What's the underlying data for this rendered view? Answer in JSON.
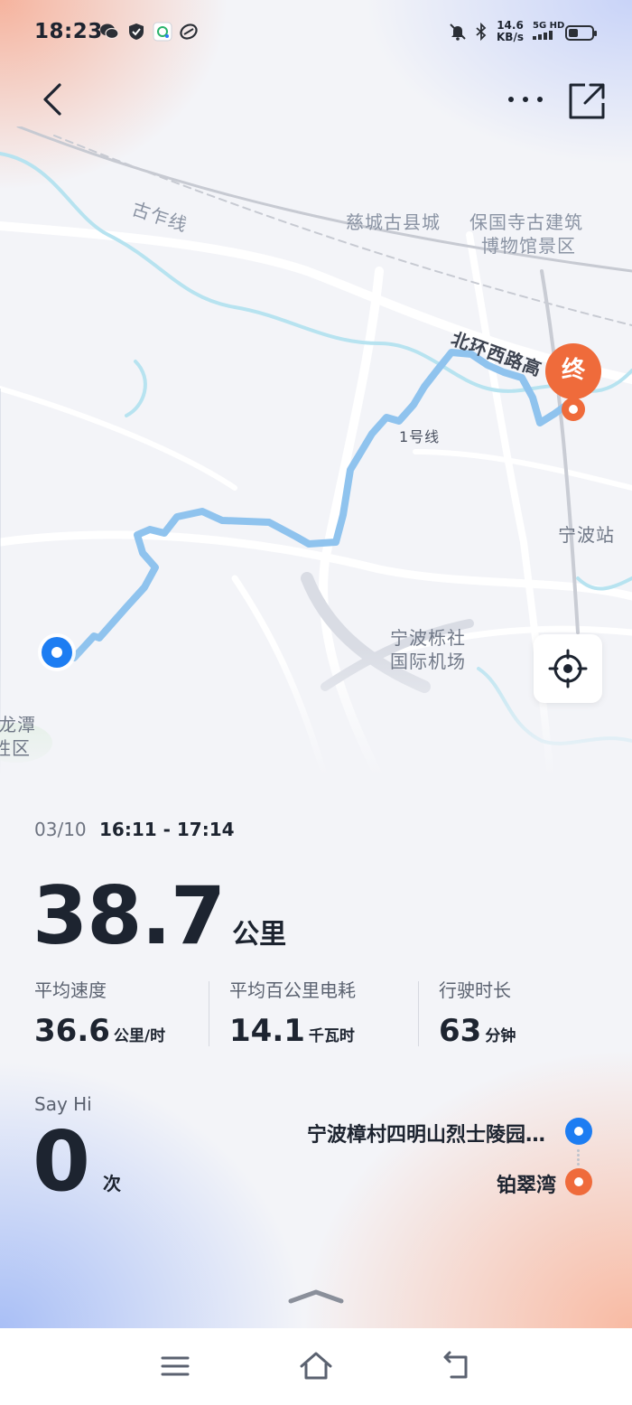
{
  "status_bar": {
    "time": "18:23",
    "speed_value": "14.6",
    "speed_unit": "KB/s",
    "network": "5G HD",
    "battery_percent": 40
  },
  "map": {
    "labels": {
      "guzha": "古乍线",
      "cicheng": "慈城古县城",
      "baoguosi_1": "保国寺古建筑",
      "baoguosi_2": "博物馆景区",
      "beihuan": "北环西路高",
      "line1": "1号线",
      "ningbo_station": "宁波站",
      "airport_1": "宁波栎社",
      "airport_2": "国际机场",
      "longtan_1": "龙潭",
      "longtan_2": "胜区"
    },
    "end_marker": "终"
  },
  "trip": {
    "date": "03/10",
    "time_range": "16:11 - 17:14",
    "distance": "38.7",
    "distance_unit": "公里",
    "stats": [
      {
        "label": "平均速度",
        "value": "36.6",
        "unit": "公里/时"
      },
      {
        "label": "平均百公里电耗",
        "value": "14.1",
        "unit": "千瓦时"
      },
      {
        "label": "行驶时长",
        "value": "63",
        "unit": "分钟"
      }
    ],
    "sayhi_label": "Say Hi",
    "sayhi_count": "0",
    "sayhi_unit": "次",
    "from": "宁波樟村四明山烈士陵园…",
    "to": "铂翠湾"
  },
  "colors": {
    "route": "#8fc3ee",
    "start": "#1d7df2",
    "end": "#ef6b3b"
  }
}
